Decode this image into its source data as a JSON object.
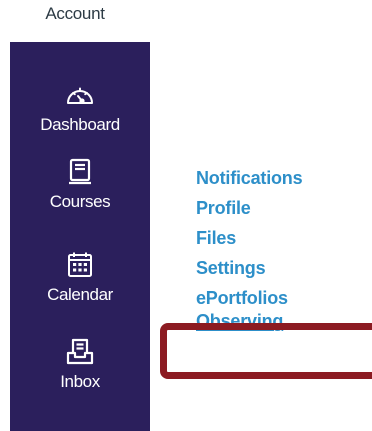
{
  "header": {
    "account_label": "Account"
  },
  "global_nav": {
    "background_color": "#2b1f5c",
    "items": [
      {
        "label": "Dashboard",
        "icon": "dashboard-speedometer-icon"
      },
      {
        "label": "Courses",
        "icon": "courses-book-icon"
      },
      {
        "label": "Calendar",
        "icon": "calendar-icon"
      },
      {
        "label": "Inbox",
        "icon": "inbox-tray-icon"
      }
    ]
  },
  "account_tray": {
    "link_color": "#2d8fc9",
    "links": [
      {
        "label": "Notifications"
      },
      {
        "label": "Profile"
      },
      {
        "label": "Files"
      },
      {
        "label": "Settings"
      },
      {
        "label": "ePortfolios"
      },
      {
        "label": "Observing"
      }
    ]
  },
  "annotation": {
    "highlight_color": "#8c1b22",
    "highlighted_item": "Observing"
  }
}
